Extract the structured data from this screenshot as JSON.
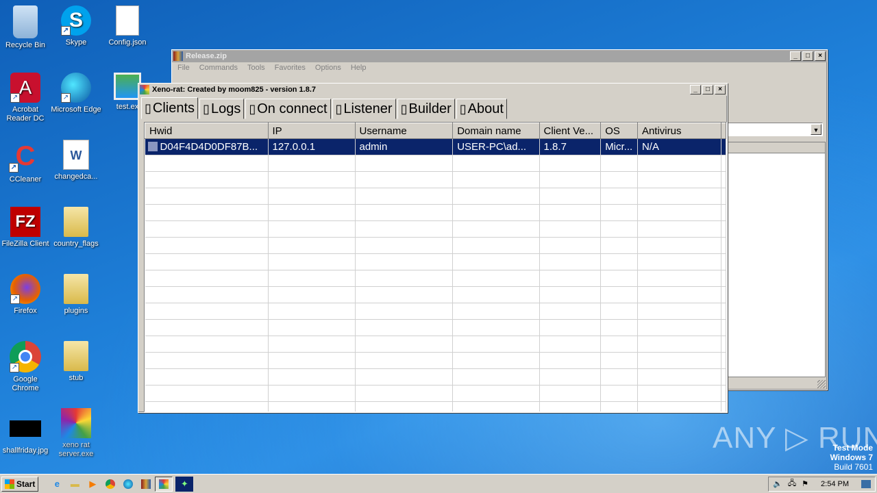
{
  "desktop": {
    "icons": [
      {
        "label": "Recycle Bin",
        "glyph": "🗑"
      },
      {
        "label": "Skype",
        "glyph": "S"
      },
      {
        "label": "Config.json",
        "glyph": ""
      },
      {
        "label": "Acrobat Reader DC",
        "glyph": "A"
      },
      {
        "label": "Microsoft Edge",
        "glyph": "e"
      },
      {
        "label": "test.ex",
        "glyph": ""
      },
      {
        "label": "CCleaner",
        "glyph": "C"
      },
      {
        "label": "changedca...",
        "glyph": "W"
      },
      {
        "label": "FileZilla Client",
        "glyph": "FZ"
      },
      {
        "label": "country_flags",
        "glyph": ""
      },
      {
        "label": "Firefox",
        "glyph": ""
      },
      {
        "label": "plugins",
        "glyph": ""
      },
      {
        "label": "Google Chrome",
        "glyph": ""
      },
      {
        "label": "stub",
        "glyph": ""
      },
      {
        "label": "shallfriday.jpg",
        "glyph": ""
      },
      {
        "label": "xeno rat server.exe",
        "glyph": ""
      }
    ]
  },
  "watermark": {
    "brand": "ANY ▷ RUN",
    "mode": "Test Mode",
    "os": "Windows 7",
    "build": "Build 7601"
  },
  "winrar": {
    "title": "Release.zip",
    "menu": [
      "File",
      "Commands",
      "Tools",
      "Favorites",
      "Options",
      "Help"
    ]
  },
  "xeno": {
    "title": "Xeno-rat: Created by moom825 - version 1.8.7",
    "tabs": [
      "Clients",
      "Logs",
      "On connect",
      "Listener",
      "Builder",
      "About"
    ],
    "columns": [
      "Hwid",
      "IP",
      "Username",
      "Domain name",
      "Client Ve...",
      "OS",
      "Antivirus"
    ],
    "rows": [
      [
        "D04F4D4D0DF87B...",
        "127.0.0.1",
        "admin",
        "USER-PC\\ad...",
        "1.8.7",
        "Micr...",
        "N/A"
      ]
    ],
    "selected_row": 0
  },
  "taskbar": {
    "start_label": "Start",
    "clock": "2:54 PM"
  },
  "colors": {
    "selection": "#0a246a",
    "desktop": "#1a6fc4",
    "face": "#d4d0c8"
  }
}
